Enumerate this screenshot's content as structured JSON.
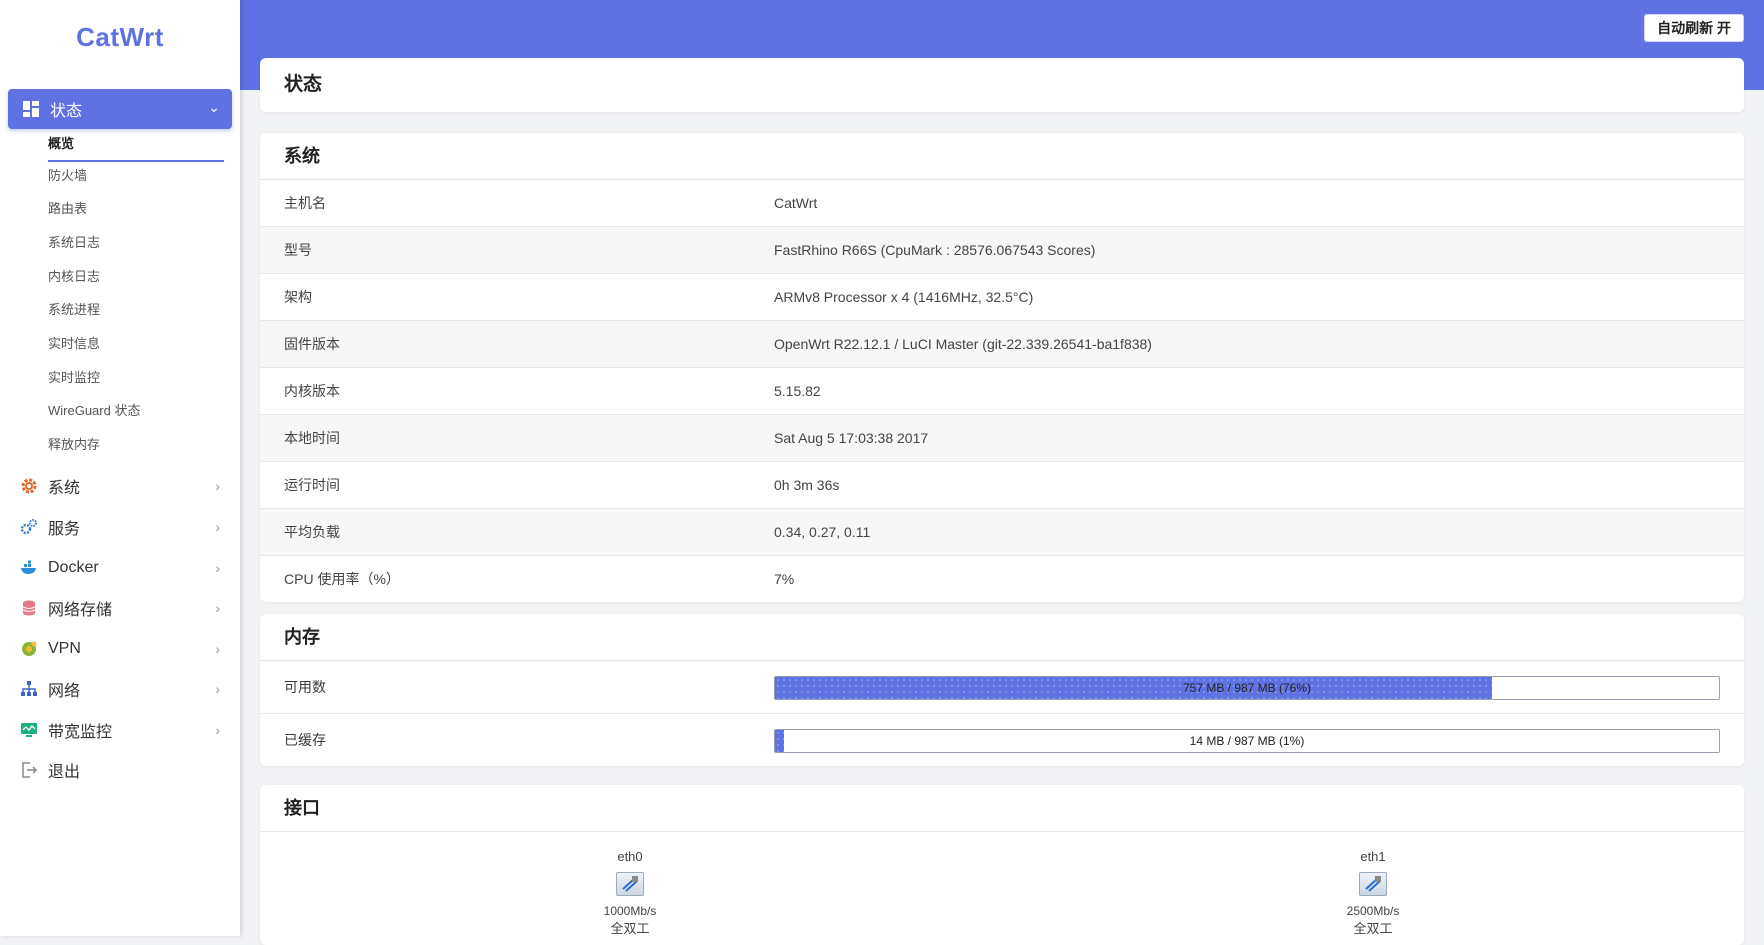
{
  "header": {
    "refresh_label": "自动刷新 开",
    "accent": "#5e72e4"
  },
  "sidebar": {
    "logo": "CatWrt",
    "active_menu": {
      "label": "状态",
      "icon": "dashboard-icon"
    },
    "submenu": [
      "概览",
      "防火墙",
      "路由表",
      "系统日志",
      "内核日志",
      "系统进程",
      "实时信息",
      "实时监控",
      "WireGuard 状态",
      "释放内存"
    ],
    "menu": [
      {
        "label": "系统",
        "icon": "gear-icon"
      },
      {
        "label": "服务",
        "icon": "cogs-icon"
      },
      {
        "label": "Docker",
        "icon": "docker-icon"
      },
      {
        "label": "网络存储",
        "icon": "database-icon"
      },
      {
        "label": "VPN",
        "icon": "vpn-icon"
      },
      {
        "label": "网络",
        "icon": "network-icon"
      },
      {
        "label": "带宽监控",
        "icon": "monitor-icon"
      },
      {
        "label": "退出",
        "icon": "logout-icon"
      }
    ]
  },
  "page": {
    "title": "状态"
  },
  "system": {
    "title": "系统",
    "rows": [
      {
        "k": "主机名",
        "v": "CatWrt"
      },
      {
        "k": "型号",
        "v": "FastRhino R66S (CpuMark : 28576.067543 Scores)"
      },
      {
        "k": "架构",
        "v": "ARMv8 Processor x 4 (1416MHz, 32.5°C)"
      },
      {
        "k": "固件版本",
        "v": "OpenWrt R22.12.1 / LuCI Master (git-22.339.26541-ba1f838)"
      },
      {
        "k": "内核版本",
        "v": "5.15.82"
      },
      {
        "k": "本地时间",
        "v": "Sat Aug 5 17:03:38 2017"
      },
      {
        "k": "运行时间",
        "v": "0h 3m 36s"
      },
      {
        "k": "平均负载",
        "v": "0.34, 0.27, 0.11"
      },
      {
        "k": "CPU 使用率（%）",
        "v": "7%"
      }
    ]
  },
  "memory": {
    "title": "内存",
    "rows": [
      {
        "k": "可用数",
        "text": "757 MB / 987 MB (76%)",
        "fraction": 0.76
      },
      {
        "k": "已缓存",
        "text": "14 MB / 987 MB (1%)",
        "fraction": 0.01
      }
    ]
  },
  "interfaces": {
    "title": "接口",
    "items": [
      {
        "name": "eth0",
        "speed": "1000Mb/s",
        "duplex": "全双工",
        "icon": "ethernet-port-icon"
      },
      {
        "name": "eth1",
        "speed": "2500Mb/s",
        "duplex": "全双工",
        "icon": "ethernet-port-icon"
      }
    ]
  }
}
